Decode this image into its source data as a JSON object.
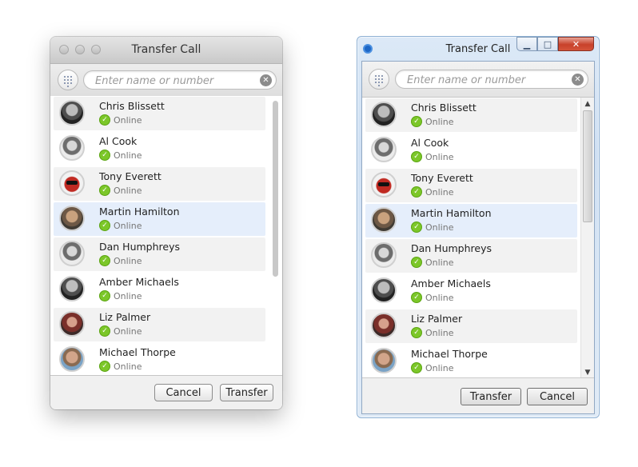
{
  "dialog_title": "Transfer Call",
  "search": {
    "placeholder": "Enter name or number",
    "value": ""
  },
  "clear_icon": "✕",
  "contacts": [
    {
      "name": "Chris Blissett",
      "status": "Online"
    },
    {
      "name": "Al Cook",
      "status": "Online"
    },
    {
      "name": "Tony Everett",
      "status": "Online"
    },
    {
      "name": "Martin Hamilton",
      "status": "Online"
    },
    {
      "name": "Dan Humphreys",
      "status": "Online"
    },
    {
      "name": "Amber Michaels",
      "status": "Online"
    },
    {
      "name": "Liz Palmer",
      "status": "Online"
    },
    {
      "name": "Michael Thorpe",
      "status": "Online"
    }
  ],
  "selected_contact": "Martin Hamilton",
  "mac_buttons": {
    "cancel": "Cancel",
    "transfer": "Transfer"
  },
  "win_buttons": {
    "transfer": "Transfer",
    "cancel": "Cancel"
  },
  "colors": {
    "online": "#7cc729",
    "selection": "#e5eefb",
    "win_close": "#c8412b"
  },
  "icons": {
    "dialpad": "dialpad-icon",
    "clear": "clear-icon",
    "status": "online-check-icon"
  }
}
